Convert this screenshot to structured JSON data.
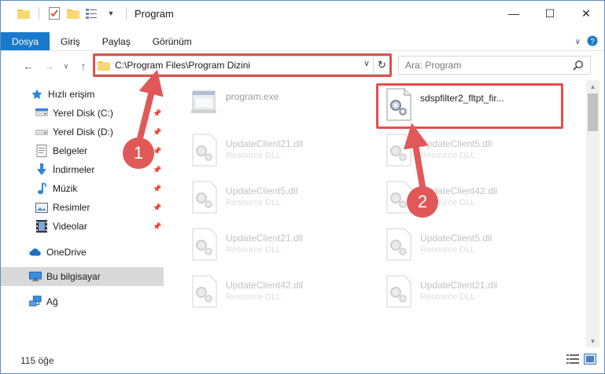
{
  "window": {
    "title": "Program"
  },
  "ribbon": {
    "tabs": [
      "Dosya",
      "Giriş",
      "Paylaş",
      "Görünüm"
    ]
  },
  "address": {
    "path": "C:\\Program Files\\Program Dizini"
  },
  "search": {
    "placeholder": "Ara: Program"
  },
  "sidebar": {
    "items": [
      {
        "label": "Hızlı erişim",
        "icon": "star-icon"
      },
      {
        "label": "Yerel Disk (C:)",
        "icon": "drive-icon",
        "pinned": true
      },
      {
        "label": "Yerel Disk (D:)",
        "icon": "drive-icon",
        "pinned": true
      },
      {
        "label": "Belgeler",
        "icon": "documents-icon",
        "pinned": true
      },
      {
        "label": "İndirmeler",
        "icon": "download-icon",
        "pinned": true
      },
      {
        "label": "Müzik",
        "icon": "music-icon",
        "pinned": true
      },
      {
        "label": "Resimler",
        "icon": "pictures-icon",
        "pinned": true
      },
      {
        "label": "Videolar",
        "icon": "video-icon",
        "pinned": true
      },
      {
        "label": "OneDrive",
        "icon": "cloud-icon"
      },
      {
        "label": "Bu bilgisayar",
        "icon": "computer-icon"
      },
      {
        "label": "Ağ",
        "icon": "network-icon"
      }
    ]
  },
  "files": [
    {
      "name": "program.exe",
      "type": ""
    },
    {
      "name": "sdspfilter2_fltpt_fir...",
      "type": ""
    },
    {
      "name": "UpdateClient21.dll",
      "type": "Resource DLL"
    },
    {
      "name": "UpdateClient5.dll",
      "type": "Resource DLL"
    },
    {
      "name": "UpdateClient5.dll",
      "type": "Resource DLL"
    },
    {
      "name": "UpdateClient42.dll",
      "type": "Resource DLL"
    },
    {
      "name": "UpdateClient21.dll",
      "type": "Resource DLL"
    },
    {
      "name": "UpdateClient5.dll",
      "type": "Resource DLL"
    },
    {
      "name": "UpdateClient42.dll",
      "type": "Resource DLL"
    },
    {
      "name": "UpdateClient21.dll",
      "type": "Resource DLL"
    }
  ],
  "status": {
    "count": "115 öğe"
  },
  "annotations": {
    "step1": "1",
    "step2": "2"
  },
  "colors": {
    "accent": "#1979ca",
    "highlight": "#e05050"
  }
}
